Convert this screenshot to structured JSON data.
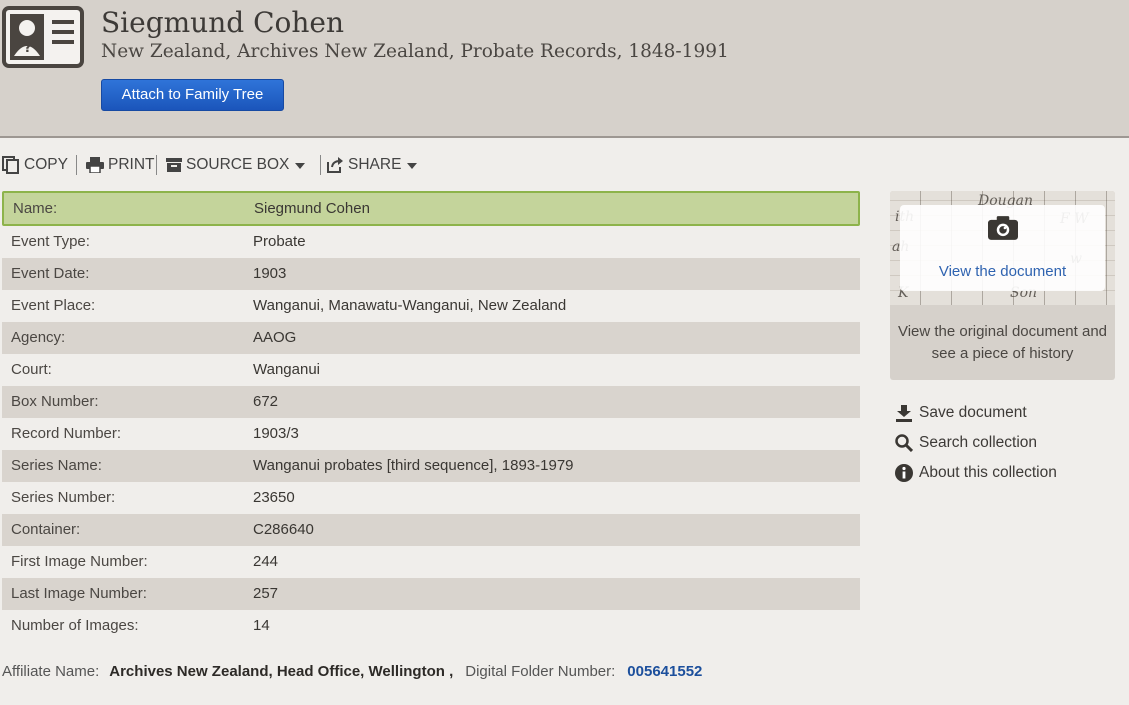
{
  "record": {
    "title": "Siegmund Cohen",
    "collection": "New Zealand, Archives New Zealand, Probate Records, 1848-1991",
    "attach_label": "Attach to Family Tree"
  },
  "toolbar": {
    "copy": "COPY",
    "print": "PRINT",
    "source_box": "SOURCE BOX",
    "share": "SHARE"
  },
  "fields": [
    {
      "label": "Name:",
      "value": "Siegmund Cohen"
    },
    {
      "label": "Event Type:",
      "value": "Probate"
    },
    {
      "label": "Event Date:",
      "value": "1903"
    },
    {
      "label": "Event Place:",
      "value": "Wanganui, Manawatu-Wanganui, New Zealand"
    },
    {
      "label": "Agency:",
      "value": "AAOG"
    },
    {
      "label": "Court:",
      "value": "Wanganui"
    },
    {
      "label": "Box Number:",
      "value": "672"
    },
    {
      "label": "Record Number:",
      "value": "1903/3"
    },
    {
      "label": "Series Name:",
      "value": "Wanganui probates [third sequence], 1893-1979"
    },
    {
      "label": "Series Number:",
      "value": "23650"
    },
    {
      "label": "Container:",
      "value": "C286640"
    },
    {
      "label": "First Image Number:",
      "value": "244"
    },
    {
      "label": "Last Image Number:",
      "value": "257"
    },
    {
      "label": "Number of Images:",
      "value": "14"
    }
  ],
  "footer": {
    "affiliate_label": "Affiliate Name:",
    "affiliate_value": "Archives New Zealand, Head Office, Wellington ,",
    "folder_label": "Digital Folder Number:",
    "folder_value": "005641552"
  },
  "document": {
    "view_link": "View the document",
    "description": "View the original document and see a piece of history"
  },
  "sidebar_links": {
    "save": "Save document",
    "search": "Search collection",
    "about": "About this collection"
  },
  "colors": {
    "header_bg": "#d6d1cb",
    "button_blue": "#1f5fc4",
    "highlight_green": "#c4d49b",
    "link_blue": "#1c4f9c"
  },
  "icons": {
    "record": "person-record-icon",
    "copy": "copy-icon",
    "print": "printer-icon",
    "source_box": "box-icon",
    "share": "share-icon",
    "camera": "camera-icon",
    "save": "download-icon",
    "search": "search-icon",
    "about": "info-icon"
  }
}
